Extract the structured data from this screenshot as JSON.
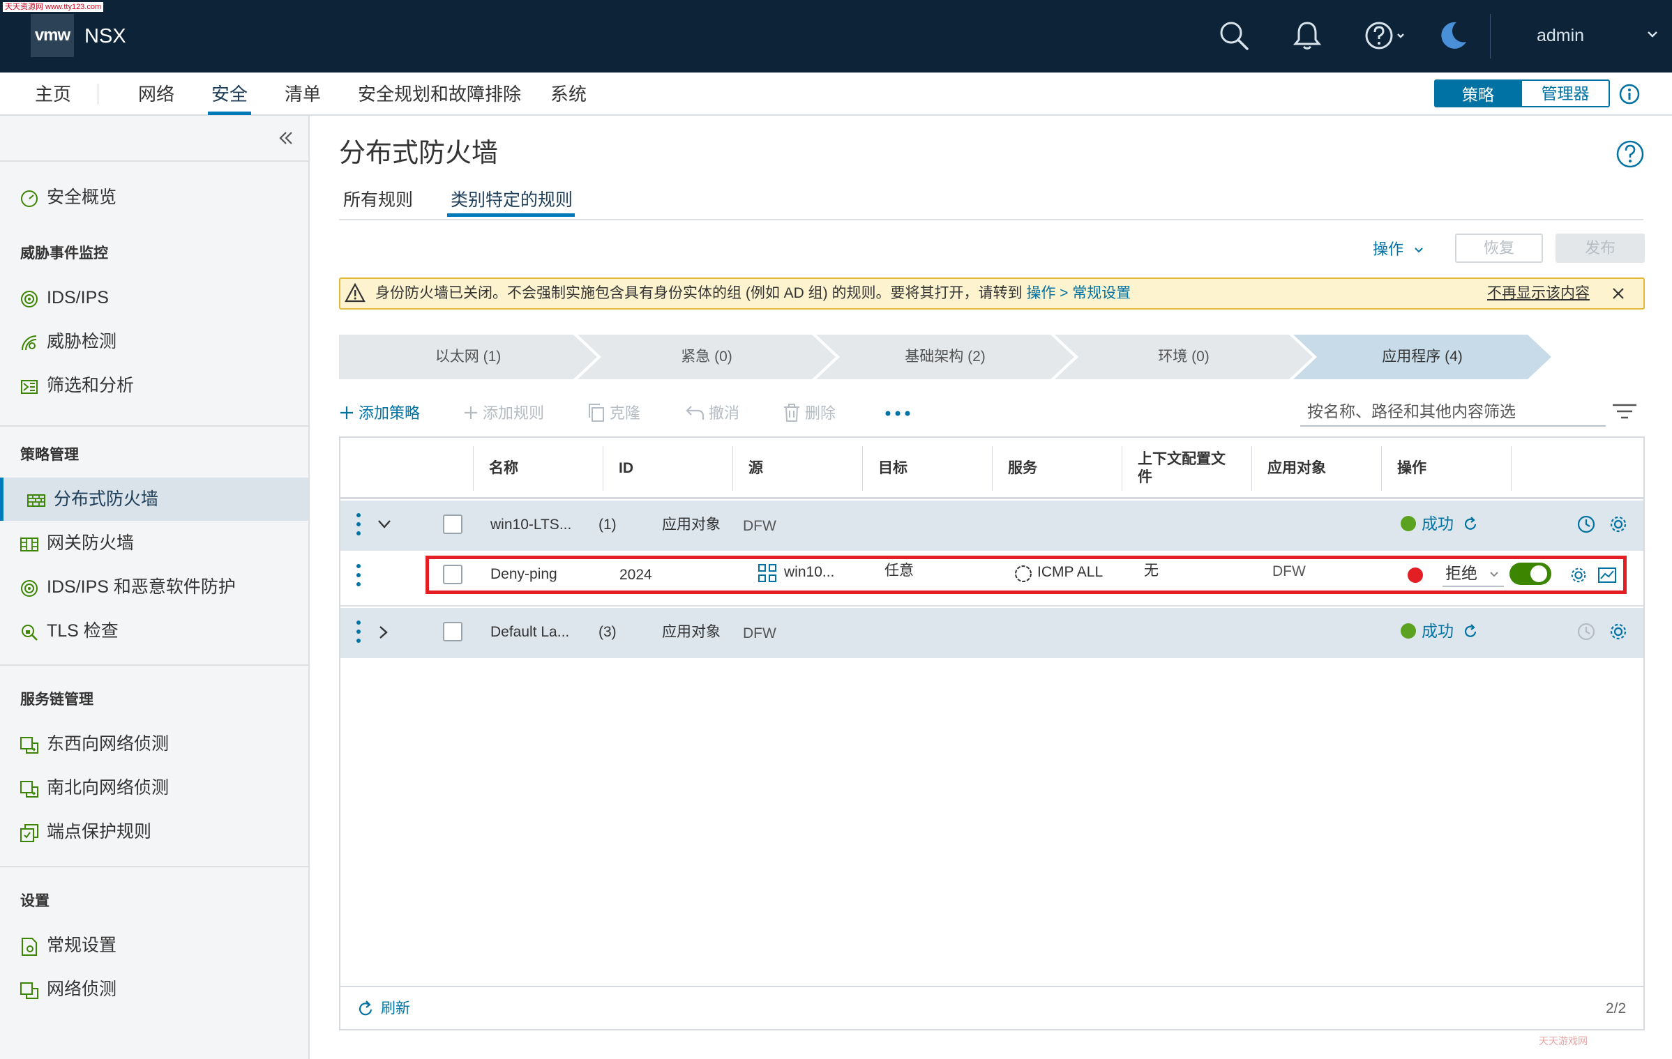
{
  "header": {
    "watermark": "天天资源网 www.tty123.com",
    "logo": "vmw",
    "app_name": "NSX",
    "user": "admin"
  },
  "nav": {
    "items": [
      "主页",
      "网络",
      "安全",
      "清单",
      "安全规划和故障排除",
      "系统"
    ],
    "active": "安全",
    "mode_policy": "策略",
    "mode_manager": "管理器"
  },
  "sidebar": {
    "overview": "安全概览",
    "section_threat": "威胁事件监控",
    "ids_ips": "IDS/IPS",
    "threat_detection": "威胁检测",
    "filter_analysis": "筛选和分析",
    "section_policy": "策略管理",
    "dfw": "分布式防火墙",
    "gateway_fw": "网关防火墙",
    "ids_malware": "IDS/IPS 和恶意软件防护",
    "tls": "TLS 检查",
    "section_service_chain": "服务链管理",
    "ew_introspection": "东西向网络侦测",
    "ns_introspection": "南北向网络侦测",
    "endpoint_rules": "端点保护规则",
    "section_settings": "设置",
    "general_settings": "常规设置",
    "network_introspection": "网络侦测"
  },
  "main": {
    "title": "分布式防火墙",
    "tabs": [
      "所有规则",
      "类别特定的规则"
    ],
    "active_tab": "类别特定的规则",
    "actions_label": "操作",
    "revert_label": "恢复",
    "publish_label": "发布",
    "alert": {
      "text": "身份防火墙已关闭。不会强制实施包含具有身份实体的组 (例如 AD 组) 的规则。要将其打开，请转到 ",
      "link": "操作 > 常规设置",
      "dismiss": "不再显示该内容"
    },
    "categories": [
      "以太网 (1)",
      "紧急 (0)",
      "基础架构 (2)",
      "环境 (0)",
      "应用程序 (4)"
    ],
    "active_category": "应用程序 (4)",
    "toolbar": {
      "add_policy": "添加策略",
      "add_rule": "添加规则",
      "clone": "克隆",
      "undo": "撤消",
      "delete": "删除",
      "filter_placeholder": "按名称、路径和其他内容筛选"
    },
    "table": {
      "columns": [
        "名称",
        "ID",
        "源",
        "目标",
        "服务",
        "上下文配置文件",
        "应用对象",
        "操作"
      ],
      "groups": [
        {
          "name": "win10-LTS...",
          "count": "(1)",
          "applied_to": "应用对象",
          "applied_value": "DFW",
          "status": "成功"
        },
        {
          "name": "Default La...",
          "count": "(3)",
          "applied_to": "应用对象",
          "applied_value": "DFW",
          "status": "成功"
        }
      ],
      "rule": {
        "name": "Deny-ping",
        "id": "2024",
        "source": "win10...",
        "destination": "任意",
        "service": "ICMP ALL",
        "context_profile": "无",
        "applied_to": "DFW",
        "action": "拒绝",
        "enabled": true
      },
      "refresh_label": "刷新",
      "page_count": "2/2"
    },
    "corner_watermark": "天天游戏网"
  },
  "colors": {
    "header_bg": "#0c2338",
    "accent": "#0072a3",
    "success": "#5aa220",
    "danger": "#e31e24",
    "toggle_on": "#3c8500"
  }
}
